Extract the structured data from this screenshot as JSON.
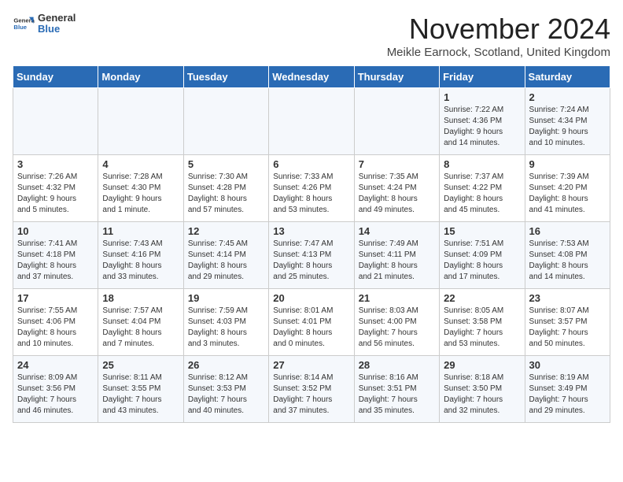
{
  "header": {
    "logo_general": "General",
    "logo_blue": "Blue",
    "title": "November 2024",
    "location": "Meikle Earnock, Scotland, United Kingdom"
  },
  "weekdays": [
    "Sunday",
    "Monday",
    "Tuesday",
    "Wednesday",
    "Thursday",
    "Friday",
    "Saturday"
  ],
  "weeks": [
    [
      {
        "day": "",
        "info": ""
      },
      {
        "day": "",
        "info": ""
      },
      {
        "day": "",
        "info": ""
      },
      {
        "day": "",
        "info": ""
      },
      {
        "day": "",
        "info": ""
      },
      {
        "day": "1",
        "info": "Sunrise: 7:22 AM\nSunset: 4:36 PM\nDaylight: 9 hours\nand 14 minutes."
      },
      {
        "day": "2",
        "info": "Sunrise: 7:24 AM\nSunset: 4:34 PM\nDaylight: 9 hours\nand 10 minutes."
      }
    ],
    [
      {
        "day": "3",
        "info": "Sunrise: 7:26 AM\nSunset: 4:32 PM\nDaylight: 9 hours\nand 5 minutes."
      },
      {
        "day": "4",
        "info": "Sunrise: 7:28 AM\nSunset: 4:30 PM\nDaylight: 9 hours\nand 1 minute."
      },
      {
        "day": "5",
        "info": "Sunrise: 7:30 AM\nSunset: 4:28 PM\nDaylight: 8 hours\nand 57 minutes."
      },
      {
        "day": "6",
        "info": "Sunrise: 7:33 AM\nSunset: 4:26 PM\nDaylight: 8 hours\nand 53 minutes."
      },
      {
        "day": "7",
        "info": "Sunrise: 7:35 AM\nSunset: 4:24 PM\nDaylight: 8 hours\nand 49 minutes."
      },
      {
        "day": "8",
        "info": "Sunrise: 7:37 AM\nSunset: 4:22 PM\nDaylight: 8 hours\nand 45 minutes."
      },
      {
        "day": "9",
        "info": "Sunrise: 7:39 AM\nSunset: 4:20 PM\nDaylight: 8 hours\nand 41 minutes."
      }
    ],
    [
      {
        "day": "10",
        "info": "Sunrise: 7:41 AM\nSunset: 4:18 PM\nDaylight: 8 hours\nand 37 minutes."
      },
      {
        "day": "11",
        "info": "Sunrise: 7:43 AM\nSunset: 4:16 PM\nDaylight: 8 hours\nand 33 minutes."
      },
      {
        "day": "12",
        "info": "Sunrise: 7:45 AM\nSunset: 4:14 PM\nDaylight: 8 hours\nand 29 minutes."
      },
      {
        "day": "13",
        "info": "Sunrise: 7:47 AM\nSunset: 4:13 PM\nDaylight: 8 hours\nand 25 minutes."
      },
      {
        "day": "14",
        "info": "Sunrise: 7:49 AM\nSunset: 4:11 PM\nDaylight: 8 hours\nand 21 minutes."
      },
      {
        "day": "15",
        "info": "Sunrise: 7:51 AM\nSunset: 4:09 PM\nDaylight: 8 hours\nand 17 minutes."
      },
      {
        "day": "16",
        "info": "Sunrise: 7:53 AM\nSunset: 4:08 PM\nDaylight: 8 hours\nand 14 minutes."
      }
    ],
    [
      {
        "day": "17",
        "info": "Sunrise: 7:55 AM\nSunset: 4:06 PM\nDaylight: 8 hours\nand 10 minutes."
      },
      {
        "day": "18",
        "info": "Sunrise: 7:57 AM\nSunset: 4:04 PM\nDaylight: 8 hours\nand 7 minutes."
      },
      {
        "day": "19",
        "info": "Sunrise: 7:59 AM\nSunset: 4:03 PM\nDaylight: 8 hours\nand 3 minutes."
      },
      {
        "day": "20",
        "info": "Sunrise: 8:01 AM\nSunset: 4:01 PM\nDaylight: 8 hours\nand 0 minutes."
      },
      {
        "day": "21",
        "info": "Sunrise: 8:03 AM\nSunset: 4:00 PM\nDaylight: 7 hours\nand 56 minutes."
      },
      {
        "day": "22",
        "info": "Sunrise: 8:05 AM\nSunset: 3:58 PM\nDaylight: 7 hours\nand 53 minutes."
      },
      {
        "day": "23",
        "info": "Sunrise: 8:07 AM\nSunset: 3:57 PM\nDaylight: 7 hours\nand 50 minutes."
      }
    ],
    [
      {
        "day": "24",
        "info": "Sunrise: 8:09 AM\nSunset: 3:56 PM\nDaylight: 7 hours\nand 46 minutes."
      },
      {
        "day": "25",
        "info": "Sunrise: 8:11 AM\nSunset: 3:55 PM\nDaylight: 7 hours\nand 43 minutes."
      },
      {
        "day": "26",
        "info": "Sunrise: 8:12 AM\nSunset: 3:53 PM\nDaylight: 7 hours\nand 40 minutes."
      },
      {
        "day": "27",
        "info": "Sunrise: 8:14 AM\nSunset: 3:52 PM\nDaylight: 7 hours\nand 37 minutes."
      },
      {
        "day": "28",
        "info": "Sunrise: 8:16 AM\nSunset: 3:51 PM\nDaylight: 7 hours\nand 35 minutes."
      },
      {
        "day": "29",
        "info": "Sunrise: 8:18 AM\nSunset: 3:50 PM\nDaylight: 7 hours\nand 32 minutes."
      },
      {
        "day": "30",
        "info": "Sunrise: 8:19 AM\nSunset: 3:49 PM\nDaylight: 7 hours\nand 29 minutes."
      }
    ]
  ]
}
